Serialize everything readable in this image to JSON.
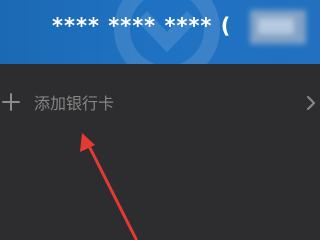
{
  "card": {
    "masked_number": "**** **** ****",
    "tail_glyph": "(",
    "banner_color": "#1f72c3"
  },
  "add_card": {
    "icon": "plus-icon",
    "label": "添加银行卡",
    "chevron": "chevron-right-icon",
    "label_color": "#858585"
  },
  "annotation": {
    "icon": "arrow-annotation",
    "color": "#e23b33"
  }
}
